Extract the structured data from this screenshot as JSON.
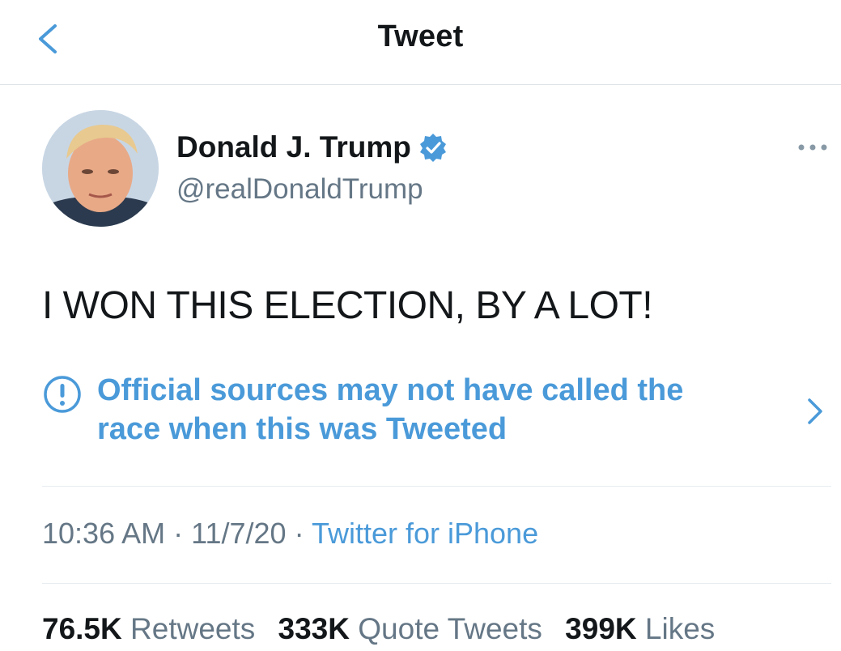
{
  "header": {
    "title": "Tweet",
    "back_icon": "chevron-left-icon"
  },
  "author": {
    "display_name": "Donald J. Trump",
    "handle": "@realDonaldTrump",
    "verified": true
  },
  "tweet": {
    "text": "I WON THIS ELECTION, BY A LOT!"
  },
  "notice": {
    "line1": "Official sources may not have called the",
    "line2": "race when this was Tweeted",
    "icon": "exclamation-circle-icon"
  },
  "meta": {
    "time": "10:36 AM",
    "date": "11/7/20",
    "separator": "·",
    "source": "Twitter for iPhone"
  },
  "stats": {
    "retweets_count": "76.5K",
    "retweets_label": "Retweets",
    "quotes_count": "333K",
    "quotes_label": "Quote Tweets",
    "likes_count": "399K",
    "likes_label": "Likes"
  },
  "colors": {
    "accent": "#4a9ad9",
    "secondary_text": "#657786",
    "primary_text": "#14171a",
    "divider": "#e6ecf0"
  }
}
